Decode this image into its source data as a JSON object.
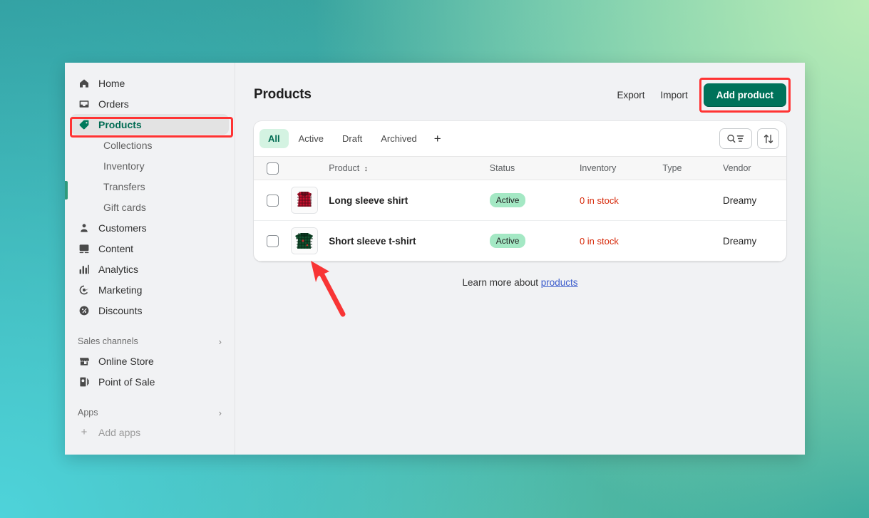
{
  "app": {
    "title": "Products"
  },
  "sidebar": {
    "items": [
      {
        "label": "Home",
        "icon": "home-icon",
        "type": "main",
        "active": false
      },
      {
        "label": "Orders",
        "icon": "orders-icon",
        "type": "main",
        "active": false
      },
      {
        "label": "Products",
        "icon": "tag-icon",
        "type": "main",
        "active": true
      },
      {
        "label": "Collections",
        "icon": "",
        "type": "sub",
        "active": false
      },
      {
        "label": "Inventory",
        "icon": "",
        "type": "sub",
        "active": false
      },
      {
        "label": "Transfers",
        "icon": "",
        "type": "sub",
        "active": false
      },
      {
        "label": "Gift cards",
        "icon": "",
        "type": "sub",
        "active": false
      },
      {
        "label": "Customers",
        "icon": "person-icon",
        "type": "main",
        "active": false
      },
      {
        "label": "Content",
        "icon": "image-icon",
        "type": "main",
        "active": false
      },
      {
        "label": "Analytics",
        "icon": "bars-icon",
        "type": "main",
        "active": false
      },
      {
        "label": "Marketing",
        "icon": "target-icon",
        "type": "main",
        "active": false
      },
      {
        "label": "Discounts",
        "icon": "discount-icon",
        "type": "main",
        "active": false
      }
    ],
    "sections": [
      {
        "title": "Sales channels",
        "chevron": "›",
        "items": [
          {
            "label": "Online Store",
            "icon": "store-icon"
          },
          {
            "label": "Point of Sale",
            "icon": "pos-icon"
          }
        ]
      },
      {
        "title": "Apps",
        "chevron": "›",
        "items": [
          {
            "label": "Add apps",
            "icon": "plus-icon"
          }
        ]
      }
    ]
  },
  "header": {
    "export_label": "Export",
    "import_label": "Import",
    "add_product_label": "Add product"
  },
  "tabs": [
    {
      "label": "All",
      "selected": true
    },
    {
      "label": "Active",
      "selected": false
    },
    {
      "label": "Draft",
      "selected": false
    },
    {
      "label": "Archived",
      "selected": false
    }
  ],
  "tab_add_label": "+",
  "tools": {
    "search_filter_icon": "search-filter-icon",
    "sort_icon": "sort-icon"
  },
  "table": {
    "columns": [
      "Product",
      "Status",
      "Inventory",
      "Type",
      "Vendor"
    ],
    "sort_indicator": "↕",
    "rows": [
      {
        "name": "Long sleeve shirt",
        "status": "Active",
        "inventory": "0 in stock",
        "type": "",
        "vendor": "Dreamy",
        "thumb": "red-plaid-long-sleeve-shirt"
      },
      {
        "name": "Short sleeve t-shirt",
        "status": "Active",
        "inventory": "0 in stock",
        "type": "",
        "vendor": "Dreamy",
        "thumb": "green-plaid-short-sleeve-shirt"
      }
    ]
  },
  "footer": {
    "learn_prefix": "Learn more about ",
    "learn_link": "products"
  },
  "colors": {
    "accent_green": "#00725a",
    "active_nav_text": "#006b52",
    "badge_bg": "#a4e8c4",
    "stock_warning": "#d72c0d",
    "highlight_red": "#ff3333",
    "link_blue": "#3a5bcc"
  }
}
